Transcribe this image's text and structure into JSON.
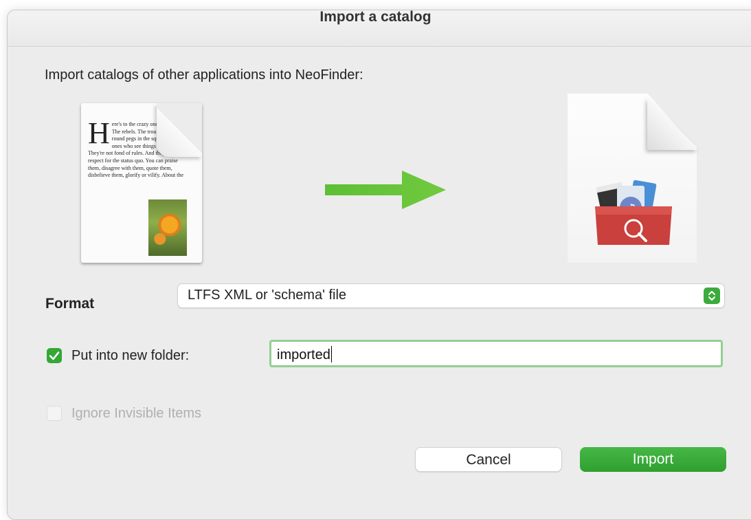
{
  "window": {
    "title": "Import a catalog"
  },
  "intro_text": "Import catalogs of other applications into NeoFinder:",
  "source_icon": {
    "icon": "text-document-icon",
    "dropcap": "H",
    "text": "ere's to the crazy ones. The misfits. The rebels. The troublemakers. The round pegs in the square holes. The ones who see things differently. They're not fond of rules. And they have no respect for the status quo. You can praise them, disagree with them, quote them, disbelieve them, glorify or vilify. About the"
  },
  "arrow_icon": "right-arrow-icon",
  "target_icon": "neofinder-catalog-file-icon",
  "format": {
    "label": "Format",
    "selected": "LTFS XML or 'schema' file"
  },
  "new_folder": {
    "checked": true,
    "label": "Put into new folder:",
    "value": "imported"
  },
  "ignore_invisible": {
    "checked": false,
    "enabled": false,
    "label": "Ignore Invisible Items"
  },
  "buttons": {
    "cancel": "Cancel",
    "import": "Import"
  },
  "colors": {
    "accent": "#3cab3c",
    "window_bg": "#ececec"
  }
}
